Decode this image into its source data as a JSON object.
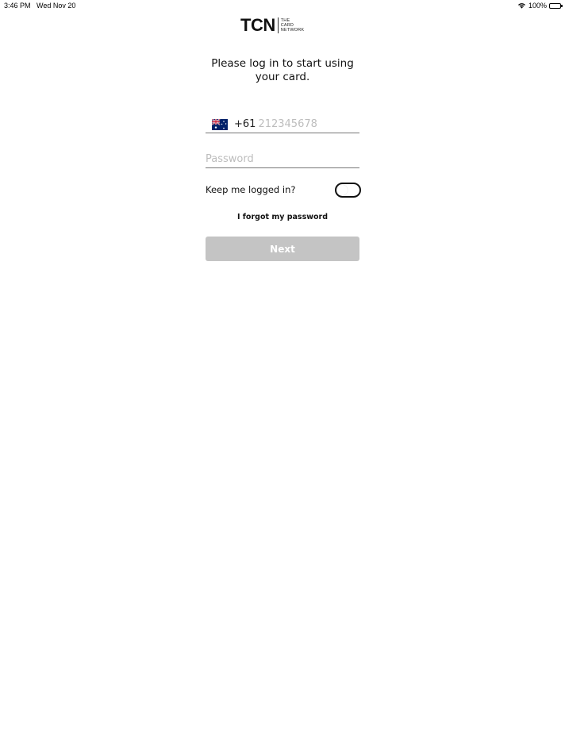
{
  "status_bar": {
    "time": "3:46 PM",
    "date": "Wed Nov 20",
    "battery": "100%",
    "icons": [
      "wifi-icon",
      "battery-icon"
    ]
  },
  "logo": {
    "mark": "TCN",
    "sub_lines": [
      "THE",
      "CARD",
      "NETWORK"
    ]
  },
  "login": {
    "heading": "Please log in to start using your card.",
    "phone": {
      "flag_icon": "australia-flag-icon",
      "country_code": "+61",
      "value": "",
      "placeholder": "212345678"
    },
    "password": {
      "value": "",
      "placeholder": "Password"
    },
    "keep_logged_in": {
      "label": "Keep me logged in?",
      "checked": false
    },
    "forgot_password_label": "I forgot my password",
    "next_button_label": "Next"
  },
  "colors": {
    "button_disabled_bg": "#c4c4c4",
    "button_text": "#ffffff",
    "placeholder": "#bdbdbd",
    "text": "#111111",
    "underline": "#777777"
  }
}
